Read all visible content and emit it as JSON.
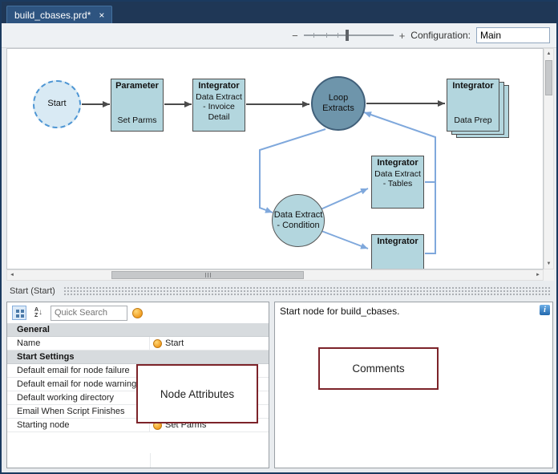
{
  "tab": {
    "title": "build_cbases.prd*",
    "close_icon": "×"
  },
  "toolbar": {
    "zoom_minus": "−",
    "zoom_plus": "+",
    "config_label": "Configuration:",
    "config_value": "Main"
  },
  "canvas": {
    "start": "Start",
    "parameter_title": "Parameter",
    "parameter_label": "Set Parms",
    "invoice_title": "Integrator",
    "invoice_label": "Data Extract - Invoice Detail",
    "loop_label": "Loop Extracts",
    "prep_title": "Integrator",
    "prep_label": "Data Prep",
    "condition_label": "Data Extract - Condition",
    "tables_title": "Integrator",
    "tables_label": "Data Extract - Tables",
    "bottom_title": "Integrator"
  },
  "scroll": {
    "up": "▲",
    "down": "▼",
    "left": "◄",
    "right": "►"
  },
  "splitter": {
    "label": "Start (Start)"
  },
  "props": {
    "search_placeholder": "Quick Search",
    "rows": [
      {
        "label": "General"
      },
      {
        "name": "Name",
        "value": "Start"
      },
      {
        "label": "Start Settings"
      },
      {
        "name": "Default email for node failure",
        "value": ""
      },
      {
        "name": "Default email for node warning",
        "value": ""
      },
      {
        "name": "Default working directory",
        "value": ""
      },
      {
        "name": "Email When Script Finishes",
        "value": ""
      },
      {
        "name": "Starting node",
        "value": "Set Parms"
      }
    ]
  },
  "comments": {
    "text": "Start node for build_cbases.",
    "info": "i"
  },
  "annotations": {
    "attributes": "Node Attributes",
    "comments": "Comments"
  },
  "colors": {
    "accent_blue": "#7fa8dc",
    "node_fill": "#b3d6de",
    "loop_fill": "#6e95ab",
    "annotation_border": "#7c2329",
    "orange_icon": "#f0991c"
  }
}
